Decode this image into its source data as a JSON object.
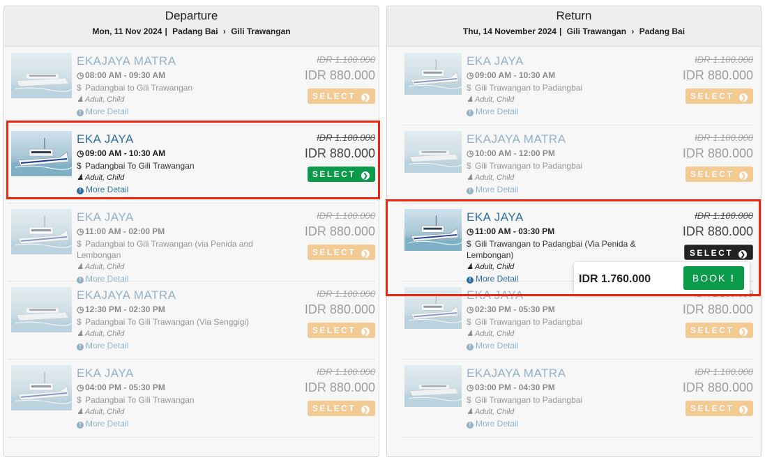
{
  "departure": {
    "title": "Departure",
    "date": "Mon, 11 Nov 2024",
    "from": "Padang Bai",
    "to": "Gili Trawangan",
    "trips": [
      {
        "name": "EKAJAYA MATRA",
        "time": "08:00 AM  -  09:30 AM",
        "route": "Padangbai to Gili Trawangan",
        "pax": "Adult, Child",
        "more": "More Detail",
        "old_price": "IDR 1.100.000",
        "price": "IDR 880.000",
        "button": "SELECT",
        "boat": "catamaran",
        "state": "faded"
      },
      {
        "name": "EKA JAYA",
        "time": "09:00 AM  -  10:30 AM",
        "route": "Padangbai To Gili Trawangan",
        "pax": "Adult, Child",
        "more": "More Detail",
        "old_price": "IDR 1.100.000",
        "price": "IDR 880.000",
        "button": "SELECT",
        "boat": "speedboat",
        "state": "selected"
      },
      {
        "name": "EKA JAYA",
        "time": "11:00 AM  -  02:00 PM",
        "route": "Padangbai to Gili Trawangan (via Penida and Lembongan",
        "pax": "Adult, Child",
        "more": "More Detail",
        "old_price": "IDR 1.100.000",
        "price": "IDR 880.000",
        "button": "SELECT",
        "boat": "speedboat",
        "state": "faded"
      },
      {
        "name": "EKAJAYA MATRA",
        "time": "12:30 PM  -  02:30 PM",
        "route": "Padangbai To Gili Trawangan (Via Senggigi)",
        "pax": "Adult, Child",
        "more": "More Detail",
        "old_price": "IDR 1.100.000",
        "price": "IDR 880.000",
        "button": "SELECT",
        "boat": "catamaran",
        "state": "faded"
      },
      {
        "name": "EKA JAYA",
        "time": "04:00 PM  -  05:30 PM",
        "route": "Padangbai To Gili Trawangan",
        "pax": "Adult, Child",
        "more": "More Detail",
        "old_price": "IDR 1.100.000",
        "price": "IDR 880.000",
        "button": "SELECT",
        "boat": "speedboat",
        "state": "faded"
      }
    ]
  },
  "return": {
    "title": "Return",
    "date": "Thu, 14 November 2024",
    "from": "Gili Trawangan",
    "to": "Padang Bai",
    "trips": [
      {
        "name": "EKA JAYA",
        "time": "09:00 AM  -  10:30 AM",
        "route": "Gili Trawangan to Padangbai",
        "pax": "Adult, Child",
        "more": "More Detail",
        "old_price": "IDR 1.100.000",
        "price": "IDR 880.000",
        "button": "SELECT",
        "boat": "speedboat",
        "state": "faded"
      },
      {
        "name": "EKAJAYA MATRA",
        "time": "10:00 AM  -  12:00 PM",
        "route": "Gili Trawangan to Padangbai",
        "pax": "Adult, Child",
        "more": "More Detail",
        "old_price": "IDR 1.100.000",
        "price": "IDR 880.000",
        "button": "SELECT",
        "boat": "catamaran",
        "state": "faded"
      },
      {
        "name": "EKA JAYA",
        "time": "11:00 AM  -  03:30 PM",
        "route": "Gili Trawangan to Padangbai (Via Penida & Lembongan)",
        "pax": "Adult, Child",
        "more": "More Detail",
        "old_price": "IDR 1.100.000",
        "price": "IDR 880.000",
        "button": "SELECT",
        "boat": "speedboat",
        "state": "selected"
      },
      {
        "name": "EKA JAYA",
        "time": "02:30 PM  -  05:30 PM",
        "route": "Gili Trawangan to Padangbai",
        "pax": "Adult, Child",
        "more": "More Detail",
        "old_price": "IDR 1.100.000",
        "price": "IDR 880.000",
        "button": "SELECT",
        "boat": "speedboat",
        "state": "faded"
      },
      {
        "name": "EKAJAYA MATRA",
        "time": "03:00 PM  -  04:30 PM",
        "route": "Gili Trawangan to Padangbai",
        "pax": "Adult, Child",
        "more": "More Detail",
        "old_price": "IDR 1.100.000",
        "price": "IDR 880.000",
        "button": "SELECT",
        "boat": "catamaran",
        "state": "faded"
      }
    ]
  },
  "booking": {
    "total": "IDR 1.760.000",
    "button": "BOOK"
  },
  "colors": {
    "highlight": "#f0260e",
    "select_orange": "#f0a030",
    "select_green": "#0a9a4a",
    "link_blue": "#2f6f9f"
  }
}
